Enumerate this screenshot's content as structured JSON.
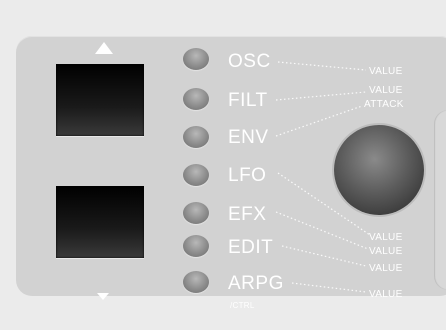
{
  "sections": [
    {
      "label": "OSC",
      "target": "VALUE"
    },
    {
      "label": "FILT",
      "target": "VALUE"
    },
    {
      "label": "ENV",
      "target": "ATTACK"
    },
    {
      "label": "LFO",
      "target": "VALUE"
    },
    {
      "label": "EFX",
      "target": "VALUE"
    },
    {
      "label": "EDIT",
      "target": "VALUE"
    },
    {
      "label": "ARPG",
      "target": "VALUE",
      "sublabel": "/CTRL"
    }
  ],
  "icons": {
    "up": "triangle-up-icon",
    "down": "triangle-down-icon"
  },
  "colors": {
    "panel": "#d2d2d2",
    "background": "#ebebeb",
    "labels": "#ffffff",
    "screen": "#000000"
  }
}
